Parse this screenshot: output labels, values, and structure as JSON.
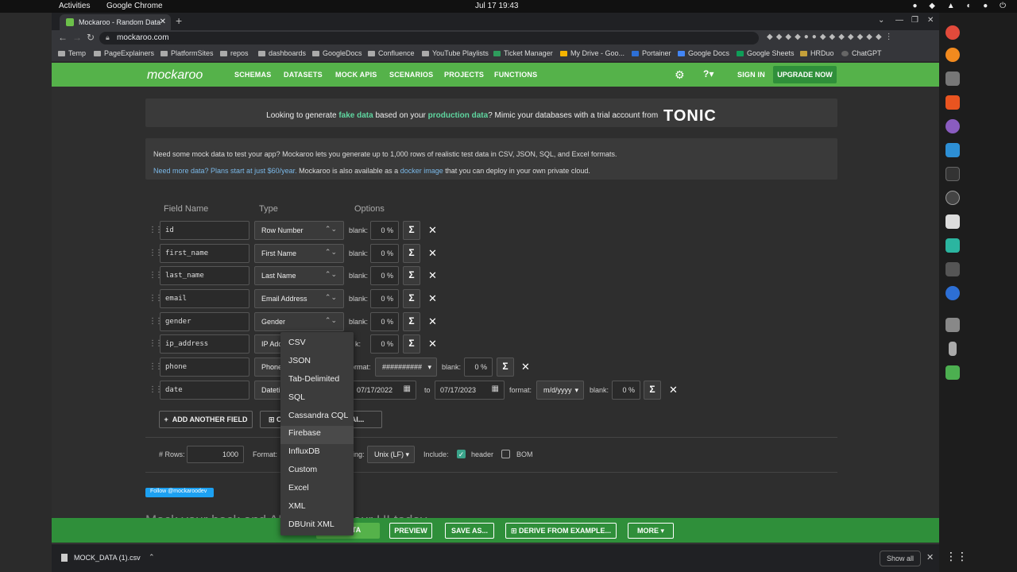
{
  "system": {
    "activities": "Activities",
    "app_name": "Google Chrome",
    "clock": "Jul 17  19:43"
  },
  "browser": {
    "tab_title": "Mockaroo - Random Data",
    "url": "mockaroo.com",
    "bookmarks": [
      "Temp",
      "PageExplainers",
      "PlatformSites",
      "repos",
      "dashboards",
      "GoogleDocs",
      "Confluence",
      "YouTube Playlists",
      "Ticket Manager",
      "My Drive - Goo...",
      "Portainer",
      "Google Docs",
      "Google Sheets",
      "HRDuo",
      "ChatGPT"
    ]
  },
  "nav": {
    "logo": "mockaroo",
    "links": [
      "SCHEMAS",
      "DATASETS",
      "MOCK APIS",
      "SCENARIOS",
      "PROJECTS",
      "FUNCTIONS"
    ],
    "sign_in": "SIGN IN",
    "upgrade": "UPGRADE NOW"
  },
  "tonic_banner": {
    "pre": "Looking to generate ",
    "fake": "fake data",
    "mid": " based on your ",
    "prod": "production data",
    "post": "? Mimic your databases with a trial account from",
    "logo": "TONIC"
  },
  "info_banner": {
    "line1": "Need some mock data to test your app? Mockaroo lets you generate up to 1,000 rows of realistic test data in CSV, JSON, SQL, and Excel formats.",
    "link1": "Need more data? Plans start at just $60/year.",
    "mid": " Mockaroo is also available as a ",
    "link2": "docker image",
    "post": " that you can deploy in your own private cloud."
  },
  "columns": {
    "field_name": "Field Name",
    "type": "Type",
    "options": "Options"
  },
  "fields": [
    {
      "name": "id",
      "type": "Row Number",
      "blank": "0 %"
    },
    {
      "name": "first_name",
      "type": "First Name",
      "blank": "0 %"
    },
    {
      "name": "last_name",
      "type": "Last Name",
      "blank": "0 %"
    },
    {
      "name": "email",
      "type": "Email Address",
      "blank": "0 %"
    },
    {
      "name": "gender",
      "type": "Gender",
      "blank": "0 %"
    },
    {
      "name": "ip_address",
      "type": "IP Add",
      "blank": "0 %"
    },
    {
      "name": "phone",
      "type": "Phone",
      "format_label": "format:",
      "format_value": "##########",
      "blank": "0 %"
    },
    {
      "name": "date",
      "type": "Dateti",
      "from": "07/17/2022",
      "to_label": "to",
      "to": "07/17/2023",
      "format_label": "format:",
      "format_value": "m/d/yyyy",
      "blank": "0 %"
    }
  ],
  "labels": {
    "blank": "blank:"
  },
  "actions": {
    "add_field": "ADD ANOTHER FIELD",
    "generate_ai": "G AI..."
  },
  "settings": {
    "rows_label": "# Rows:",
    "rows_value": "1000",
    "format_label": "Format:",
    "line_ending_label": "ing:",
    "line_ending_value": "Unix (LF)",
    "include_label": "Include:",
    "header_label": "header",
    "bom_label": "BOM"
  },
  "follow": "Follow @mockaroodev",
  "headline": "Mock your back and API... ...ding your UI today",
  "bottom_bar": {
    "download": "E DATA",
    "preview": "PREVIEW",
    "save_as": "SAVE AS...",
    "derive": "DERIVE FROM EXAMPLE...",
    "more": "MORE"
  },
  "format_menu": [
    "CSV",
    "JSON",
    "Tab-Delimited",
    "SQL",
    "Cassandra CQL",
    "Firebase",
    "InfluxDB",
    "Custom",
    "Excel",
    "XML",
    "DBUnit XML"
  ],
  "download_shelf": {
    "file": "MOCK_DATA (1).csv",
    "show_all": "Show all"
  },
  "colors": {
    "brand_green": "#55b24a",
    "dark_green": "#2f8f3a",
    "accent": "#5fd6a0"
  }
}
